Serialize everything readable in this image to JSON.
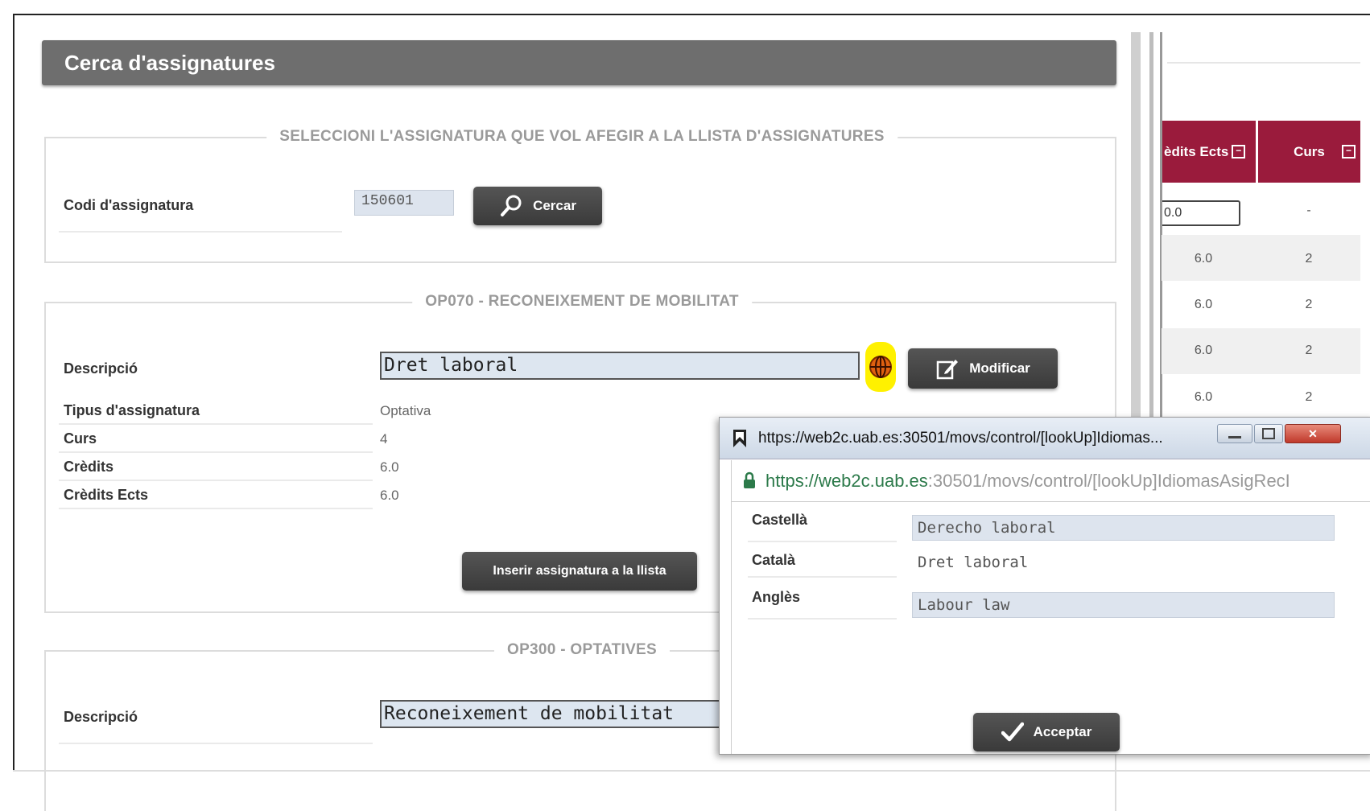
{
  "page": {
    "title": "Cerca d'assignatures"
  },
  "search_section": {
    "legend": "SELECCIONI L'ASSIGNATURA QUE VOL AFEGIR A LA LLISTA D'ASSIGNATURES",
    "code_label": "Codi d'assignatura",
    "code_value": "150601",
    "search_button": "Cercar"
  },
  "subject_section": {
    "legend": "OP070 - RECONEIXEMENT DE MOBILITAT",
    "description_label": "Descripció",
    "description_value": "Dret laboral",
    "modify_button": "Modificar",
    "fields": [
      {
        "label": "Tipus d'assignatura",
        "value": "Optativa"
      },
      {
        "label": "Curs",
        "value": "4"
      },
      {
        "label": "Crèdits",
        "value": "6.0"
      },
      {
        "label": "Crèdits Ects",
        "value": "6.0"
      }
    ],
    "insert_button": "Inserir assignatura a la llista"
  },
  "optatives_section": {
    "legend": "OP300 - OPTATIVES",
    "description_label": "Descripció",
    "description_value": "Reconeixement de mobilitat"
  },
  "table": {
    "headers": [
      "èdits Ects",
      "Curs"
    ],
    "input_row": {
      "ects": "0.0",
      "curs": "-"
    },
    "rows": [
      {
        "ects": "6.0",
        "curs": "2"
      },
      {
        "ects": "6.0",
        "curs": "2"
      },
      {
        "ects": "6.0",
        "curs": "2"
      },
      {
        "ects": "6.0",
        "curs": "2"
      }
    ],
    "header_color": "#9a1b3c"
  },
  "popup": {
    "title": "https://web2c.uab.es:30501/movs/control/[lookUp]Idiomas...",
    "url_host": "https://web2c.uab.es",
    "url_path": ":30501/movs/control/[lookUp]IdiomasAsigRecI",
    "fields": [
      {
        "label": "Castellà",
        "value": "Derecho laboral"
      },
      {
        "label": "Català",
        "value": "Dret laboral"
      },
      {
        "label": "Anglès",
        "value": "Labour law"
      }
    ],
    "accept_button": "Acceptar",
    "window_controls": [
      "minimize",
      "maximize",
      "close"
    ]
  },
  "icons": [
    "search-icon",
    "edit-icon",
    "globe-icon",
    "check-icon",
    "bookmark-icon",
    "lock-icon"
  ]
}
